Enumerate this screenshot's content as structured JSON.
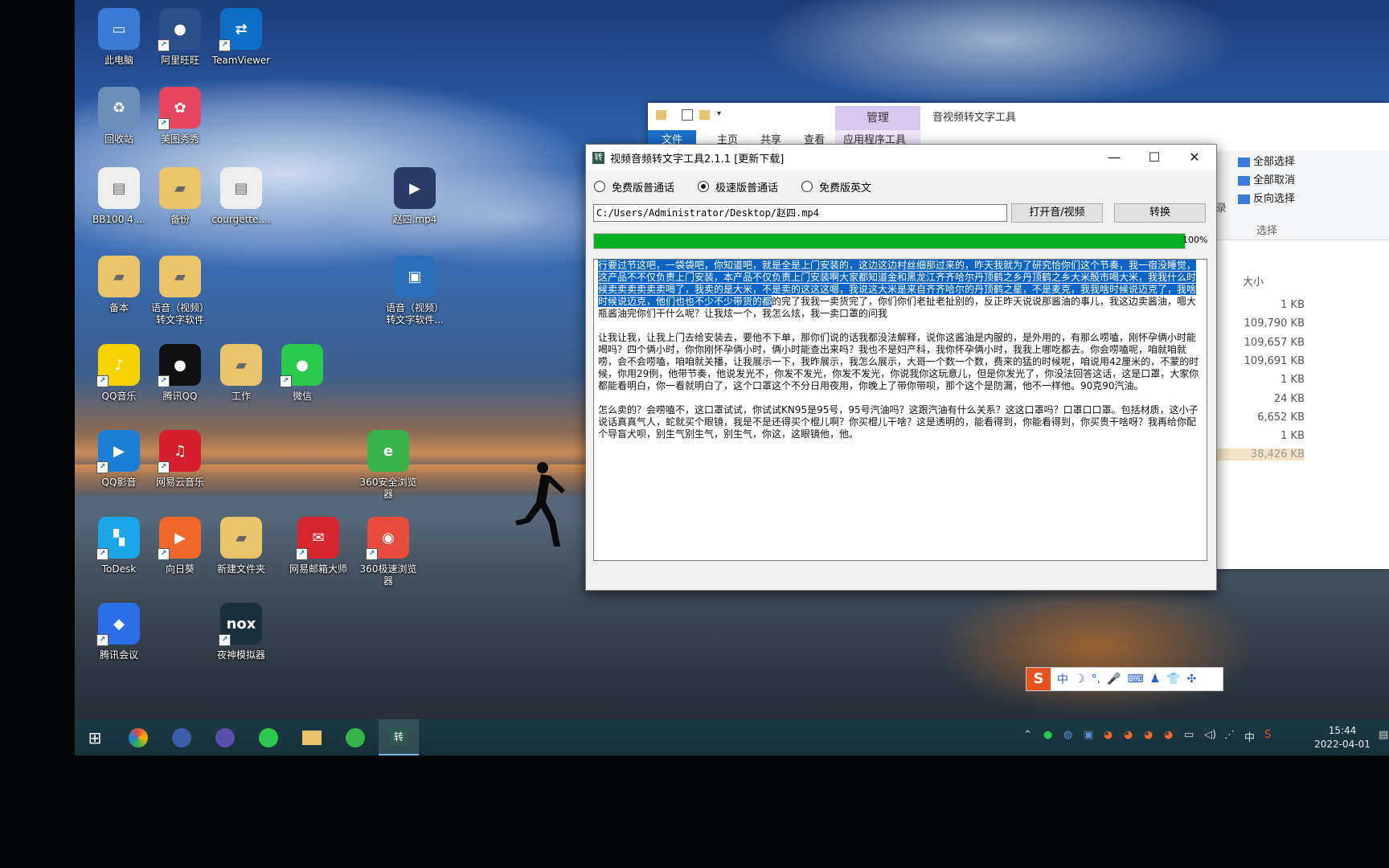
{
  "desktop": {
    "icons": [
      {
        "label": "此电脑",
        "color": "#3a7bd5",
        "glyph": "▭"
      },
      {
        "label": "阿里旺旺",
        "color": "#2a4f8a",
        "glyph": "●"
      },
      {
        "label": "TeamViewer",
        "color": "#0e6fc9",
        "glyph": "⇄"
      },
      {
        "label": "回收站",
        "color": "#6a8fb8",
        "glyph": "♻"
      },
      {
        "label": "美图秀秀",
        "color": "#e84560",
        "glyph": "✿"
      },
      {
        "label": "BB100 4 ...",
        "color": "#eeeeee",
        "glyph": "▤"
      },
      {
        "label": "备份",
        "color": "#e9c46a",
        "glyph": "▰"
      },
      {
        "label": "courgette....",
        "color": "#eeeeee",
        "glyph": "▤"
      },
      {
        "label": "赵四.mp4",
        "color": "#2b3a66",
        "glyph": "▶"
      },
      {
        "label": "备本",
        "color": "#e9c46a",
        "glyph": "▰"
      },
      {
        "label": "语音（视频）\n转文字软件",
        "color": "#e9c46a",
        "glyph": "▰"
      },
      {
        "label": "语音（视频）\n转文字软件...",
        "color": "#2a6fb8",
        "glyph": "▣"
      },
      {
        "label": "QQ音乐",
        "color": "#f5d200",
        "glyph": "♪"
      },
      {
        "label": "腾讯QQ",
        "color": "#111111",
        "glyph": "●"
      },
      {
        "label": "工作",
        "color": "#e9c46a",
        "glyph": "▰"
      },
      {
        "label": "微信",
        "color": "#2ac94e",
        "glyph": "●"
      },
      {
        "label": "QQ影音",
        "color": "#1c7fd6",
        "glyph": "▶"
      },
      {
        "label": "网易云音乐",
        "color": "#d71e2b",
        "glyph": "♫"
      },
      {
        "label": "360安全浏览\n器",
        "color": "#37b34a",
        "glyph": "e"
      },
      {
        "label": "ToDesk",
        "color": "#1aa6e8",
        "glyph": "▚"
      },
      {
        "label": "向日葵",
        "color": "#f0672a",
        "glyph": "▶"
      },
      {
        "label": "新建文件夹",
        "color": "#e9c46a",
        "glyph": "▰"
      },
      {
        "label": "网易邮箱大师",
        "color": "#d7262e",
        "glyph": "✉"
      },
      {
        "label": "360极速浏览\n器",
        "color": "#e94b3c",
        "glyph": "◉"
      },
      {
        "label": "腾讯会议",
        "color": "#2b6ee8",
        "glyph": "◆"
      },
      {
        "label": "夜神模拟器",
        "color": "#1b2f3a",
        "glyph": "nox"
      }
    ]
  },
  "explorer": {
    "manage_tab": "管理",
    "window_title": "音视频转文字工具",
    "tabs": [
      "文件",
      "主页",
      "共享",
      "查看",
      "应用程序工具"
    ],
    "select_group": [
      "全部选择",
      "全部取消",
      "反向选择"
    ],
    "select_group_title": "选择",
    "partial_label": "录",
    "column_size": "大小",
    "sizes": [
      "1 KB",
      "109,790 KB",
      "109,657 KB",
      "109,691 KB",
      "1 KB",
      "24 KB",
      "6,652 KB",
      "1 KB",
      "38,426 KB"
    ]
  },
  "dialog": {
    "app_icon": "转",
    "title": "视频音频转文字工具2.1.1 [更新下载]",
    "minimize": "—",
    "maximize": "☐",
    "close": "✕",
    "radios": [
      {
        "label": "免费版普通话",
        "selected": false
      },
      {
        "label": "极速版普通话",
        "selected": true
      },
      {
        "label": "免费版英文",
        "selected": false
      }
    ],
    "path": "C:/Users/Administrator/Desktop/赵四.mp4",
    "open_button": "打开音/视频",
    "convert_button": "转换",
    "progress": 100,
    "progress_label": "100%",
    "text_highlighted": "行要过节这吧，一袋袋吧，你知道吧，就是全是上门安装的，这边这边村丝细那过来的，昨天我就为了研究恰你们这个节奏，我一宿没睡觉，这产品不不仅负责上门安装，本产品不仅负责上门安装啊大家都知道金和黑龙江齐齐哈尔丹顶鹤之乡丹顶鹤之乡大米殷市喝大米，我我什么时候卖卖卖卖卖卖喝了，我卖的是大米，不是卖的这这这嗯，我说这大米是来自齐齐哈尔的丹顶鹤之星，不是麦克，我我啥时候说迈克了，我啥时候说迈克，他们也也不少不少带货的都",
    "text_rest": "的完了我我一卖货完了，你们你们老扯老扯别的，反正昨天说说那酱油的事儿，我这边卖酱油，嗯大瓶酱油完你们干什么呢？让我炫一个，我怎么炫，我一卖口罩的问我",
    "paragraph2": "让我让我，让我上门去给安装去，要他不下单，那你们说的话我都没法解释，说你这酱油是内服的，是外用的，有那么唠嗑，刚怀孕俩小时能喝吗？四个俩小时，你你刚怀孕俩小时，俩小时能查出来吗？我也不是妇产科，我你怀孕俩小时，我我上哪吃都去。你会唠嗑呢，咱就咱就唠，会不会唠嗑，咱咱就关播，让我展示一下，我昨展示，我怎么展示，大哥一个数一个数，费来的猛的时候呢，咱说用42厘米的，不蒙的时候，你用29例，他带节奏，他说发光不，你发不发光，你发不发光，你说我你这玩意儿，但是你发光了，你没法回答这话，这是口罩，大家你都能看明白，你一看就明白了，这个口罩这个不分日用夜用，你晚上了带你带呗，那个这个是防漏，他不一样他。90克90汽油。",
    "paragraph3": "怎么卖的？会唠嗑不，这口罩试试，你试试KN95是95号，95号汽油吗？这跟汽油有什么关系？这这口罩吗？口罩口口罩。包括材质，这小子说话真真气人，蛇就买个眼镜，我是不是还得买个棍儿啊？你买棍儿干啥？这是透明的，能看得到，你能看得到，你买贵干啥呀？我再给你配个导盲犬呗，别生气别生气，别生气，你这，这眼镜他，他。"
  },
  "ime": {
    "logo": "S",
    "items": [
      "中",
      "☽",
      "°,",
      "🎤",
      "⌨",
      "♟",
      "👕",
      "✣"
    ]
  },
  "taskbar": {
    "start": "⊞",
    "apps": [
      "360极速浏览器",
      "阿里旺旺",
      "QQ",
      "微信",
      "文件资源管理器",
      "360安全浏览器",
      "转"
    ],
    "tray_ime": "中",
    "time": "15:44",
    "date": "2022-04-01"
  }
}
